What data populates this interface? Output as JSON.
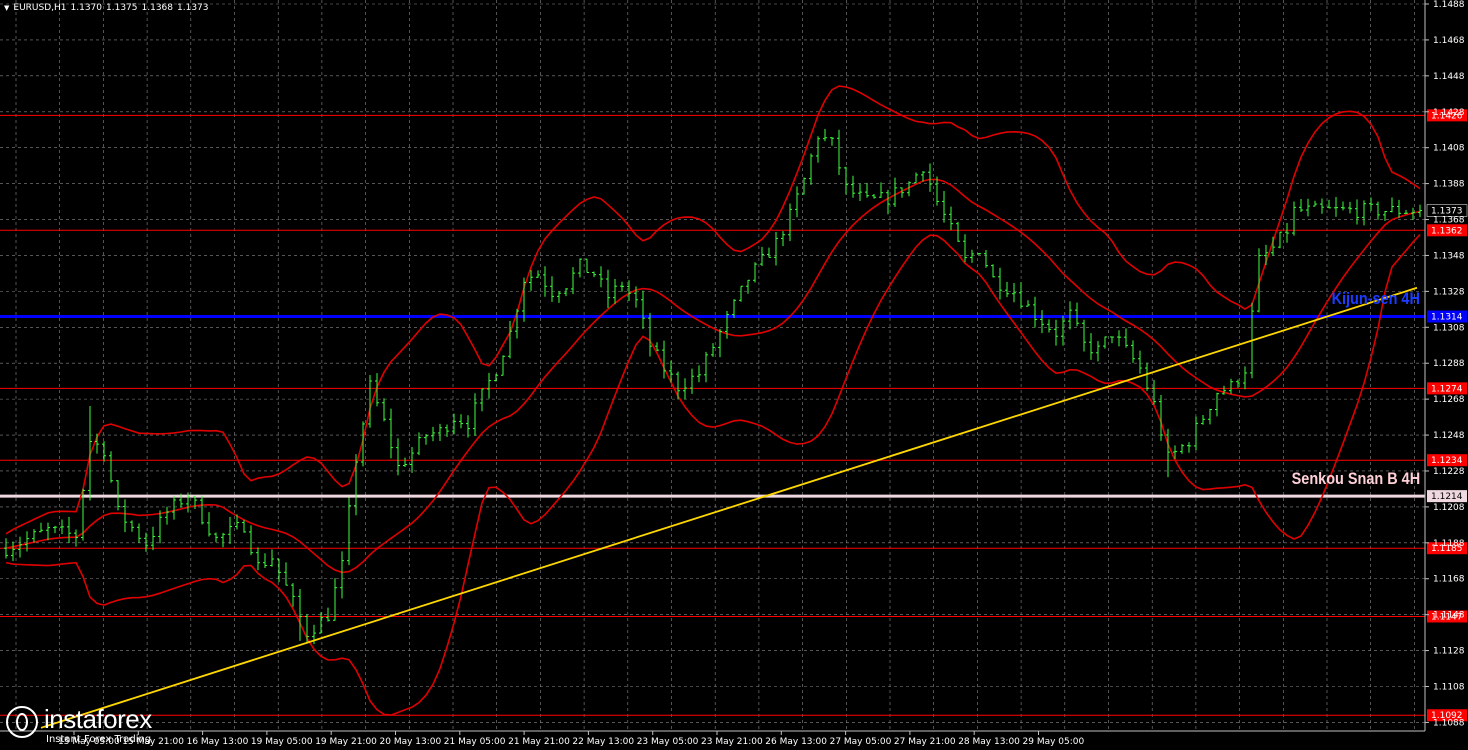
{
  "header": {
    "symbol": "EURUSD,H1",
    "open": "1.1370",
    "high": "1.1375",
    "low": "1.1368",
    "close": "1.1373"
  },
  "chart_data": {
    "type": "candlestick",
    "ylim": [
      1.1081,
      1.1488
    ],
    "y_ticks": [
      "1.1488",
      "1.1468",
      "1.1448",
      "1.1428",
      "1.1408",
      "1.1388",
      "1.1368",
      "1.1348",
      "1.1328",
      "1.1308",
      "1.1288",
      "1.1268",
      "1.1248",
      "1.1228",
      "1.1208",
      "1.1188",
      "1.1168",
      "1.1148",
      "1.1128",
      "1.1108",
      "1.1088"
    ],
    "x_ticks": [
      "15 May 05:00",
      "15 May 21:00",
      "16 May 13:00",
      "19 May 05:00",
      "19 May 21:00",
      "20 May 13:00",
      "21 May 05:00",
      "21 May 21:00",
      "22 May 13:00",
      "23 May 05:00",
      "23 May 21:00",
      "26 May 13:00",
      "27 May 05:00",
      "27 May 21:00",
      "28 May 13:00",
      "29 May 05:00"
    ],
    "grid": true,
    "price_levels": [
      {
        "value": 1.1426,
        "label": "1.1426",
        "color": "#ff0000"
      },
      {
        "value": 1.1362,
        "label": "1.1362",
        "color": "#ff0000"
      },
      {
        "value": 1.1274,
        "label": "1.1274",
        "color": "#ff0000"
      },
      {
        "value": 1.1234,
        "label": "1.1234",
        "color": "#ff0000"
      },
      {
        "value": 1.1185,
        "label": "1.1185",
        "color": "#ff0000"
      },
      {
        "value": 1.1147,
        "label": "1.1147",
        "color": "#ff0000"
      },
      {
        "value": 1.1092,
        "label": "1.1092",
        "color": "#ff0000"
      }
    ],
    "kijun_sen_4h": {
      "value": 1.1314,
      "label": "1.1314",
      "name": "Kijun-sen 4H",
      "color": "#0000ff"
    },
    "senkou_span_b_4h": {
      "value": 1.1214,
      "label": "1.1214",
      "name": "Senkou Snan B 4H",
      "color": "#ffc0cb"
    },
    "current_price": {
      "value": 1.1373,
      "label": "1.1373"
    },
    "bar_count": 203,
    "trendline": {
      "from_bar": 5,
      "from_price": 1.1085,
      "to_bar": 183,
      "to_price": 1.1308,
      "color": "#ffd700"
    },
    "price_anchors": [
      [
        0,
        1.1185
      ],
      [
        3,
        1.119
      ],
      [
        6,
        1.1195
      ],
      [
        10,
        1.1192
      ],
      [
        12,
        1.1245
      ],
      [
        14,
        1.124
      ],
      [
        16,
        1.1205
      ],
      [
        20,
        1.1188
      ],
      [
        23,
        1.1205
      ],
      [
        26,
        1.1215
      ],
      [
        30,
        1.119
      ],
      [
        34,
        1.1198
      ],
      [
        36,
        1.1175
      ],
      [
        38,
        1.118
      ],
      [
        41,
        1.1155
      ],
      [
        43,
        1.1138
      ],
      [
        46,
        1.1148
      ],
      [
        48,
        1.1175
      ],
      [
        50,
        1.1235
      ],
      [
        52,
        1.1275
      ],
      [
        54,
        1.1255
      ],
      [
        56,
        1.123
      ],
      [
        58,
        1.1238
      ],
      [
        60,
        1.1248
      ],
      [
        62,
        1.125
      ],
      [
        64,
        1.1258
      ],
      [
        66,
        1.1255
      ],
      [
        68,
        1.127
      ],
      [
        70,
        1.1285
      ],
      [
        72,
        1.1305
      ],
      [
        74,
        1.1335
      ],
      [
        76,
        1.1338
      ],
      [
        78,
        1.1328
      ],
      [
        80,
        1.1332
      ],
      [
        82,
        1.1342
      ],
      [
        84,
        1.1338
      ],
      [
        86,
        1.1325
      ],
      [
        88,
        1.1332
      ],
      [
        90,
        1.1322
      ],
      [
        92,
        1.1298
      ],
      [
        94,
        1.1285
      ],
      [
        96,
        1.1275
      ],
      [
        99,
        1.1282
      ],
      [
        102,
        1.1305
      ],
      [
        104,
        1.132
      ],
      [
        106,
        1.1335
      ],
      [
        108,
        1.1345
      ],
      [
        110,
        1.1355
      ],
      [
        112,
        1.137
      ],
      [
        114,
        1.139
      ],
      [
        116,
        1.1415
      ],
      [
        118,
        1.141
      ],
      [
        120,
        1.1385
      ],
      [
        123,
        1.1378
      ],
      [
        126,
        1.138
      ],
      [
        129,
        1.1388
      ],
      [
        131,
        1.1398
      ],
      [
        133,
        1.1378
      ],
      [
        135,
        1.1362
      ],
      [
        137,
        1.1345
      ],
      [
        139,
        1.1352
      ],
      [
        141,
        1.1335
      ],
      [
        144,
        1.1328
      ],
      [
        147,
        1.1315
      ],
      [
        150,
        1.1305
      ],
      [
        152,
        1.1315
      ],
      [
        154,
        1.1298
      ],
      [
        156,
        1.1295
      ],
      [
        158,
        1.1305
      ],
      [
        160,
        1.1295
      ],
      [
        162,
        1.1285
      ],
      [
        164,
        1.1265
      ],
      [
        166,
        1.1235
      ],
      [
        167,
        1.1238
      ],
      [
        169,
        1.1245
      ],
      [
        171,
        1.1258
      ],
      [
        173,
        1.1272
      ],
      [
        175,
        1.1275
      ],
      [
        177,
        1.1285
      ],
      [
        179,
        1.1345
      ],
      [
        181,
        1.1352
      ],
      [
        183,
        1.1362
      ],
      [
        184,
        1.1373
      ]
    ]
  }
}
